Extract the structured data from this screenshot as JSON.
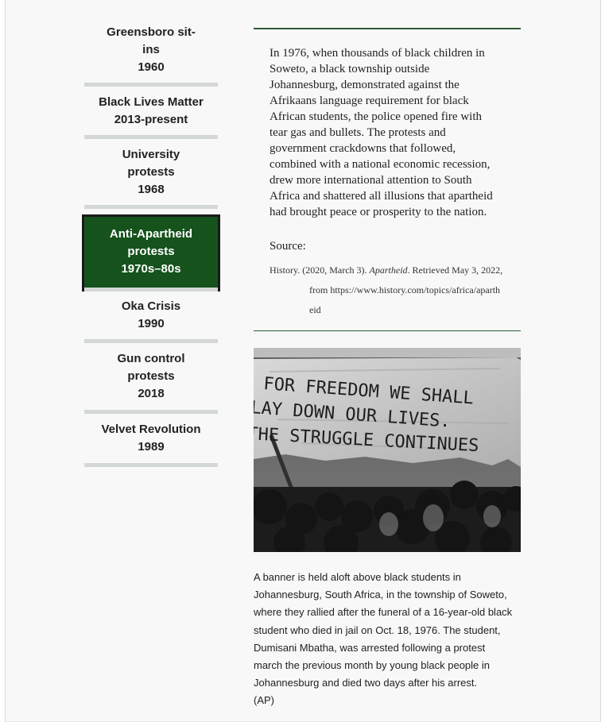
{
  "nav": {
    "items": [
      {
        "lines": [
          "Greensboro sit-",
          "ins",
          "1960"
        ],
        "active": false
      },
      {
        "lines": [
          "Black Lives Matter",
          "2013-present"
        ],
        "active": false
      },
      {
        "lines": [
          "University",
          "protests",
          "1968"
        ],
        "active": false
      },
      {
        "lines": [
          "Anti-Apartheid",
          "protests",
          "1970s–80s"
        ],
        "active": true
      },
      {
        "lines": [
          "Oka Crisis",
          "1990"
        ],
        "active": false
      },
      {
        "lines": [
          "Gun control",
          "protests",
          "2018"
        ],
        "active": false
      },
      {
        "lines": [
          "Velvet Revolution",
          "1989"
        ],
        "active": false
      }
    ]
  },
  "article": {
    "quote_lines": [
      "In 1976, when thousands of black children in",
      "Soweto, a black township outside",
      "Johannesburg, demonstrated against the",
      "Afrikaans language requirement for black",
      "African students, the police opened fire with",
      "tear gas and bullets. The protests and",
      "government crackdowns that followed,",
      "combined with a national economic recession,",
      "drew more international attention to South",
      "Africa and shattered all illusions that apartheid",
      "had brought peace or prosperity to the nation."
    ],
    "source_label": "Source:",
    "citation": {
      "before": "History. (2020, March 3). ",
      "title": "Apartheid",
      "after": ". Retrieved May 3, 2022, from https://www.history.com/topics/africa/apartheid"
    }
  },
  "photo": {
    "banner_lines": [
      "FOR FREEDOM WE SHALL",
      "LAY DOWN OUR LIVES.",
      "THE STRUGGLE CONTINUES"
    ]
  },
  "caption": {
    "lines": [
      "A banner is held aloft above black students in",
      "Johannesburg, South Africa, in the township of Soweto,",
      "where they rallied after the funeral of a 16-year-old black",
      "student who died in jail on Oct. 18, 1976. The student,",
      "Dumisani Mbatha, was arrested following a protest",
      "march the previous month by young black people in",
      "Johannesburg and died two days after his arrest.",
      "(AP)"
    ]
  },
  "colors": {
    "active_nav": "#15521c",
    "rule": "#2c5a34",
    "nav_divider": "#d3d8d7"
  }
}
